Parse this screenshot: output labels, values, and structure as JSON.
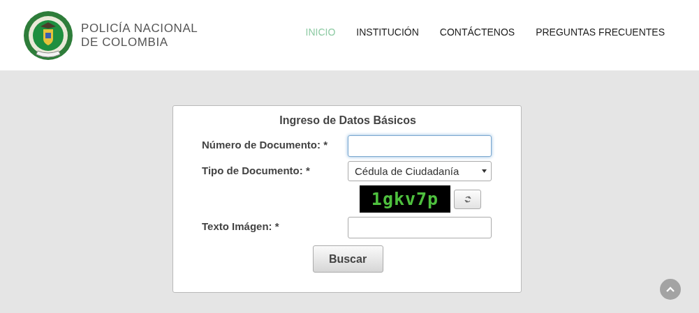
{
  "header": {
    "title_line_1": "POLICÍA NACIONAL",
    "title_line_2": "DE COLOMBIA",
    "nav": [
      {
        "label": "INICIO",
        "selected": true
      },
      {
        "label": "INSTITUCIÓN",
        "selected": false
      },
      {
        "label": "CONTÁCTENOS",
        "selected": false
      },
      {
        "label": "PREGUNTAS FRECUENTES",
        "selected": false
      }
    ]
  },
  "form": {
    "title": "Ingreso de Datos Básicos",
    "document_number": {
      "label": "Número de Documento: *",
      "focused": true
    },
    "document_type": {
      "label": "Tipo de Documento: *",
      "value": "Cédula de Ciudadanía"
    },
    "captcha_text": "1gkv7p",
    "image_text": {
      "label": "Texto Imágen: *"
    },
    "submit": "Buscar"
  }
}
